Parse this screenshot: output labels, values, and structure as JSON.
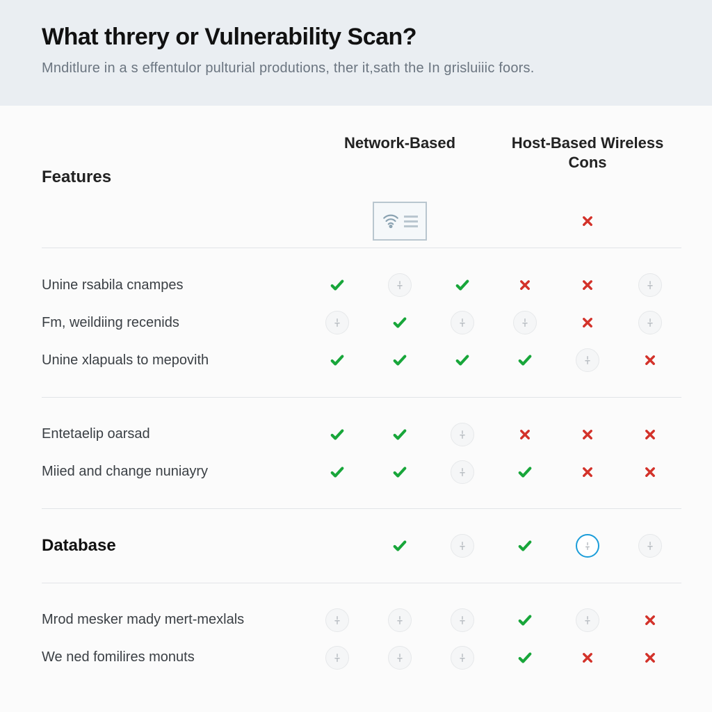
{
  "hero": {
    "title": "What threry or Vulnerability Scan?",
    "subtitle": "Mnditlure in a s effentulor pulturial produtions, ther it,sath the In grisluiiic foors."
  },
  "columns": {
    "group_a": "Network-Based",
    "group_b": "Host-Based Wireless Cons"
  },
  "sections": [
    {
      "heading": "Features",
      "heading_icons": [
        "",
        "device",
        "",
        "",
        "cross",
        ""
      ],
      "rows": [
        {
          "label": "Unine rsabila cnampes",
          "cells": [
            "check",
            "pict",
            "check",
            "cross",
            "cross",
            "pict"
          ]
        },
        {
          "label": "Fm, weildiing recenids",
          "cells": [
            "pict",
            "check",
            "pict",
            "pict",
            "cross",
            "pict"
          ]
        },
        {
          "label": "Unine xlapuals to mepovith",
          "cells": [
            "check",
            "check",
            "check",
            "check",
            "pict",
            "cross"
          ]
        }
      ]
    },
    {
      "heading": "",
      "rows": [
        {
          "label": "Entetaelip oarsad",
          "cells": [
            "check",
            "check",
            "pict",
            "cross",
            "cross",
            "cross"
          ]
        },
        {
          "label": "Miied and change nuniayry",
          "cells": [
            "check",
            "check",
            "pict",
            "check",
            "cross",
            "cross"
          ]
        }
      ]
    },
    {
      "heading": "Database",
      "heading_icons": [
        "",
        "check",
        "pict",
        "check",
        "blue",
        "pict"
      ],
      "rows": [
        {
          "label": "Mrod mesker mady mert-mexlals",
          "cells": [
            "pict",
            "pict",
            "pict",
            "check",
            "pict",
            "cross"
          ]
        },
        {
          "label": "We ned fomilires monuts",
          "cells": [
            "pict",
            "pict",
            "pict",
            "check",
            "cross",
            "cross"
          ]
        }
      ]
    }
  ]
}
